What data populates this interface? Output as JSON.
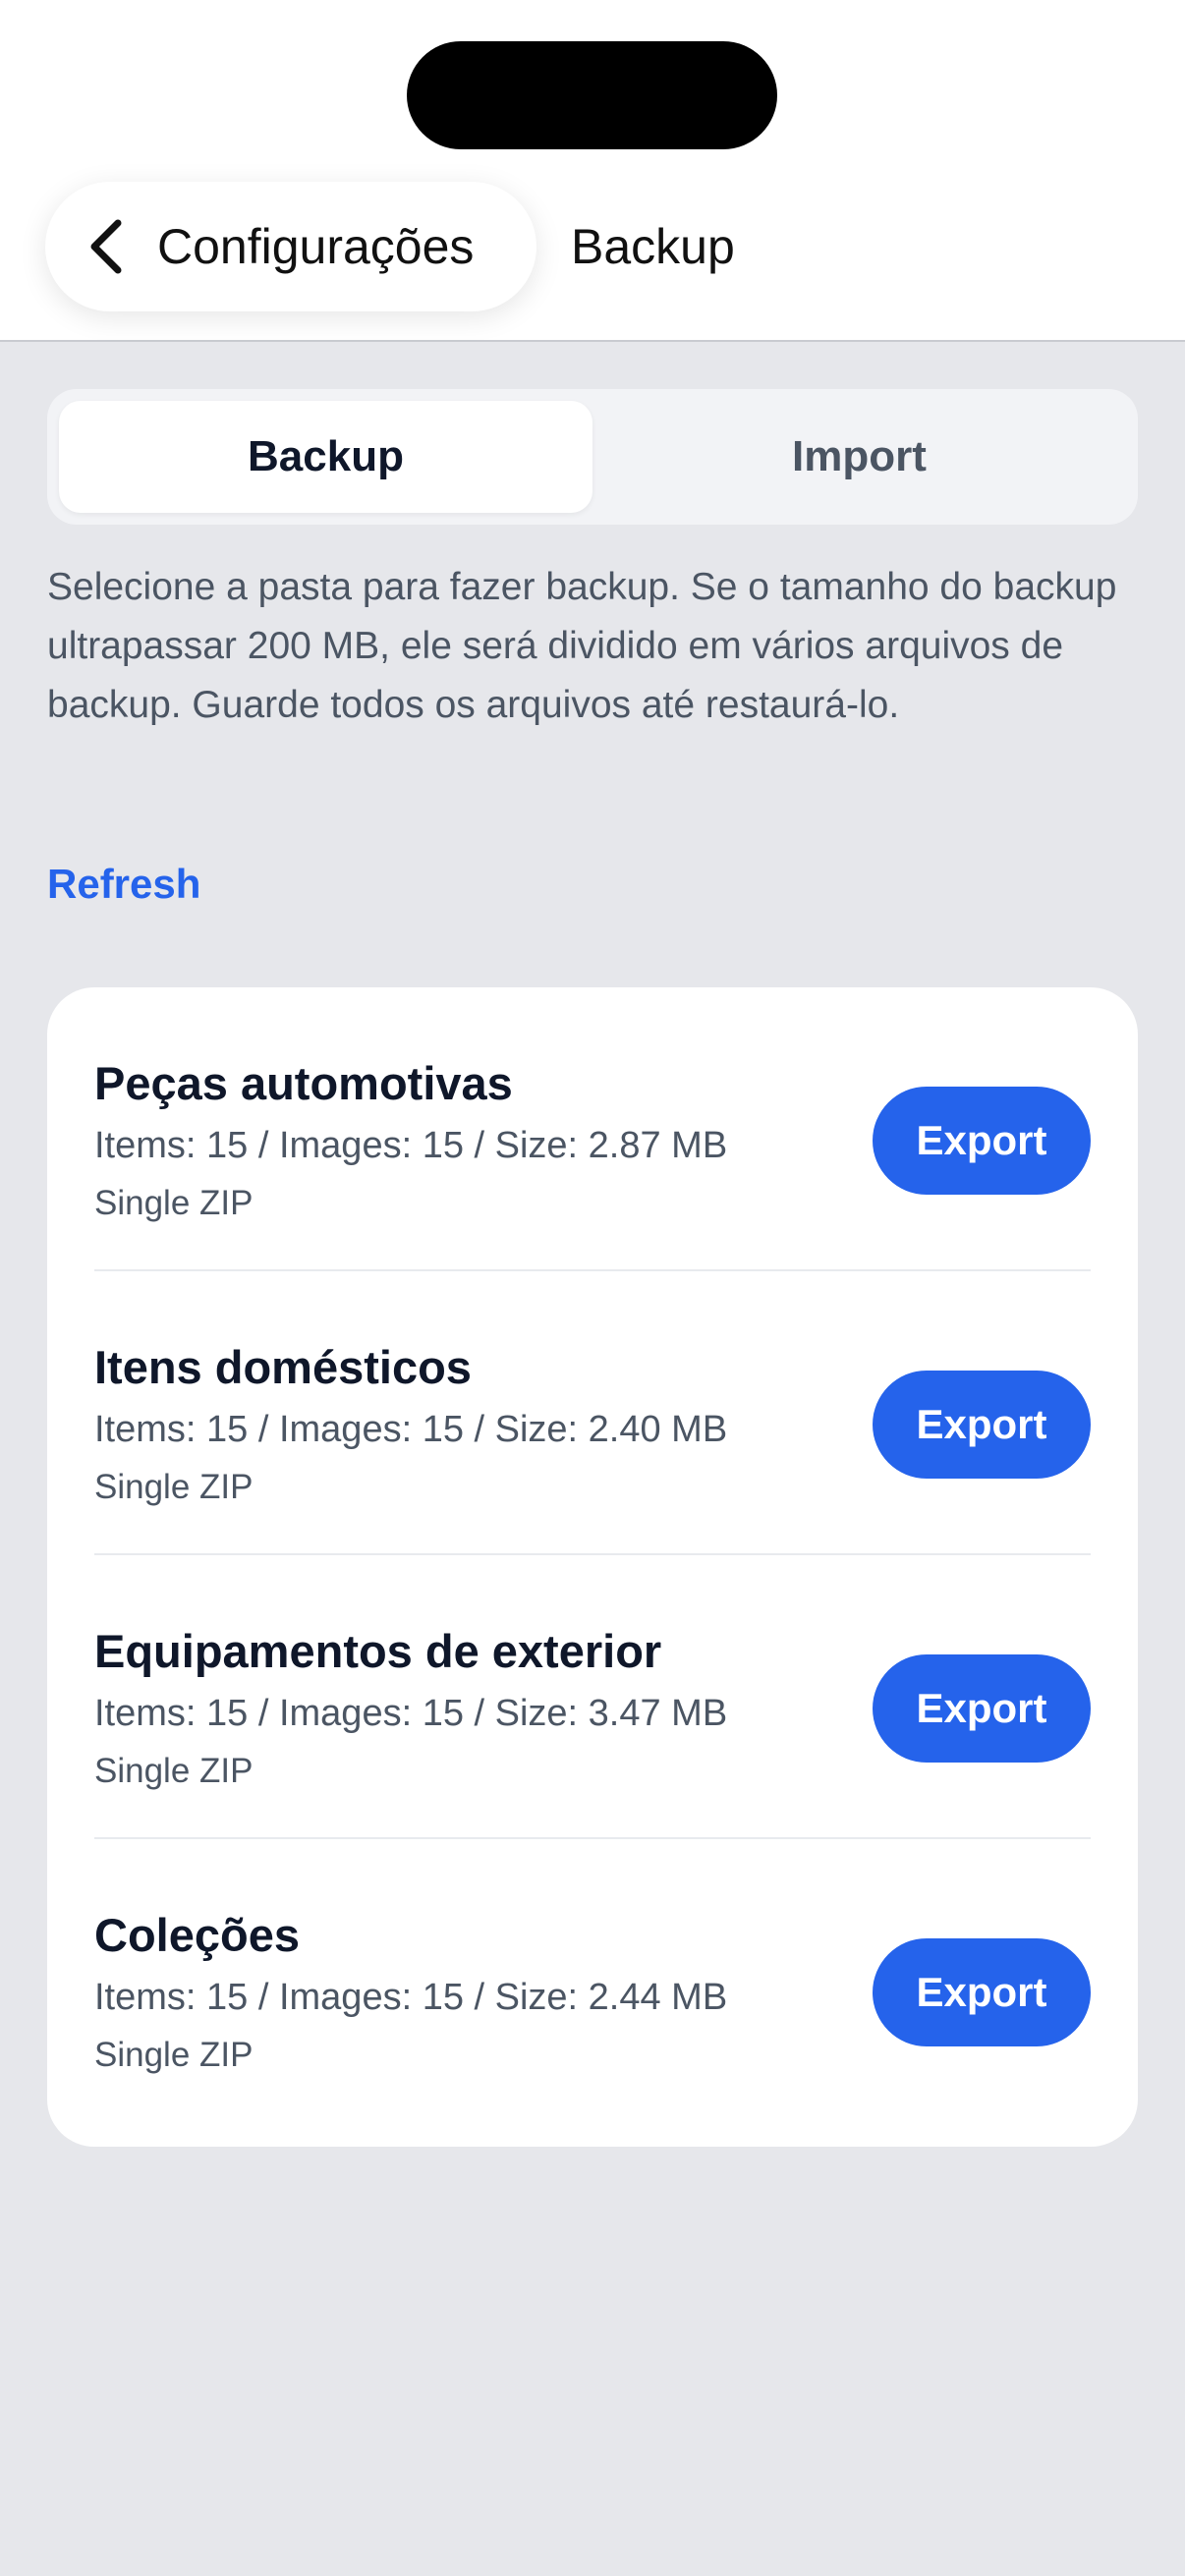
{
  "nav": {
    "back_label": "Configurações",
    "title": "Backup"
  },
  "tabs": [
    {
      "label": "Backup",
      "active": true
    },
    {
      "label": "Import",
      "active": false
    }
  ],
  "description": "Selecione a pasta para fazer backup. Se o tamanho do backup ultrapassar 200 MB, ele será dividido em vários arquivos de backup. Guarde todos os arquivos até restaurá-lo.",
  "refresh_label": "Refresh",
  "folders": [
    {
      "name": "Peças automotivas",
      "meta": "Items: 15 / Images: 15 / Size: 2.87 MB",
      "type": "Single ZIP",
      "action": "Export"
    },
    {
      "name": "Itens domésticos",
      "meta": "Items: 15 / Images: 15 / Size: 2.40 MB",
      "type": "Single ZIP",
      "action": "Export"
    },
    {
      "name": "Equipamentos de exterior",
      "meta": "Items: 15 / Images: 15 / Size: 3.47 MB",
      "type": "Single ZIP",
      "action": "Export"
    },
    {
      "name": "Coleções",
      "meta": "Items: 15 / Images: 15 / Size: 2.44 MB",
      "type": "Single ZIP",
      "action": "Export"
    }
  ],
  "colors": {
    "accent": "#2563eb",
    "background": "#e6e7eb",
    "card": "#ffffff"
  },
  "icons": {
    "back": "chevron-left-icon"
  }
}
